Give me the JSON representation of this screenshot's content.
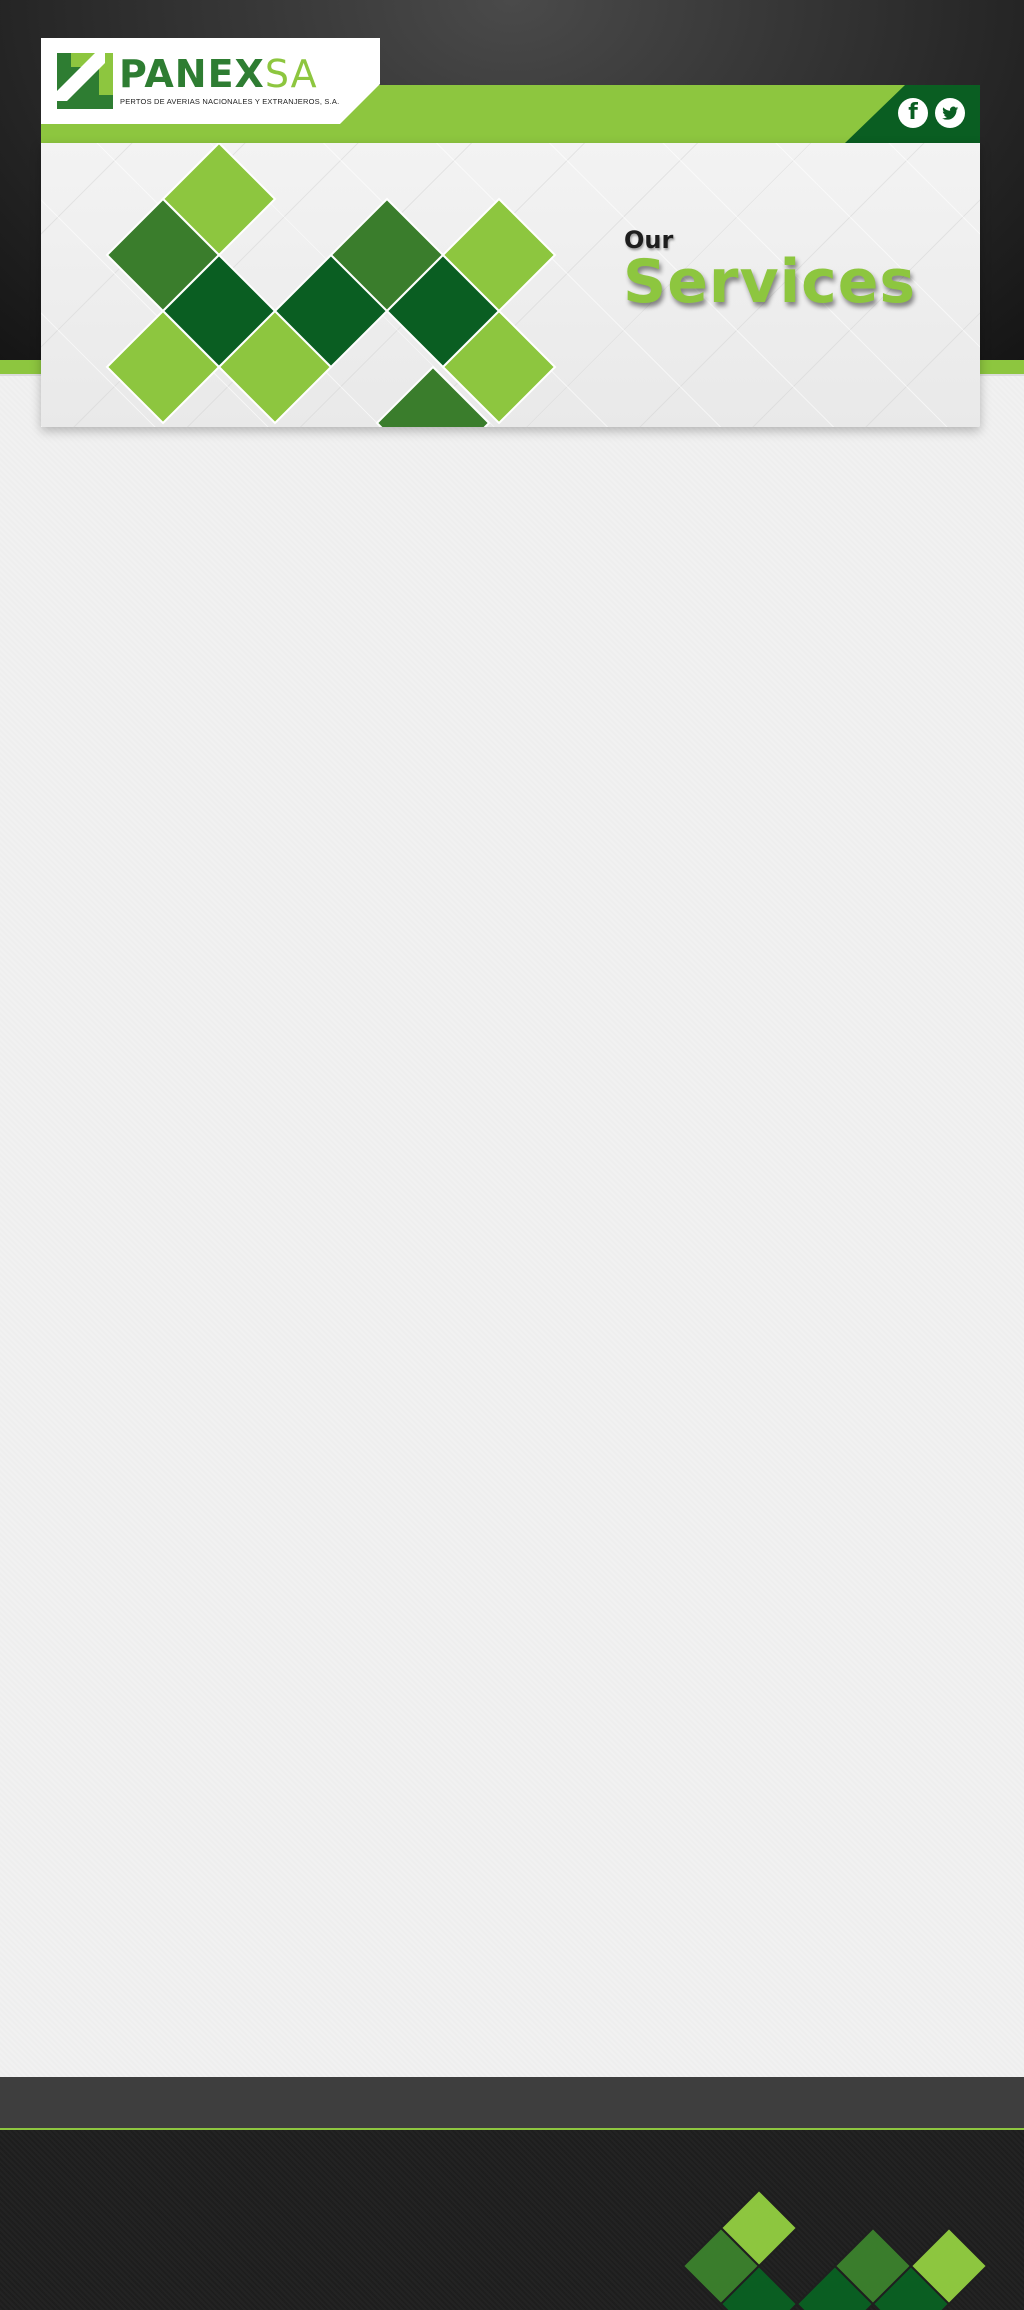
{
  "brand": {
    "name_strong": "PANEX",
    "name_light": "SA",
    "tagline": "PERTOS DE AVERIAS NACIONALES Y EXTRANJEROS, S.A."
  },
  "social": {
    "facebook_glyph": "f",
    "twitter_glyph": "❧"
  },
  "banner": {
    "title_small": "Our",
    "title_large": "Services"
  },
  "colors": {
    "accent_green": "#8dc63f",
    "mid_green": "#3a7d2c",
    "dark_green": "#0a5e22",
    "dark_bg": "#2b2b2b"
  },
  "icons": [
    "facebook-icon",
    "twitter-icon",
    "panex-logo-mark"
  ]
}
